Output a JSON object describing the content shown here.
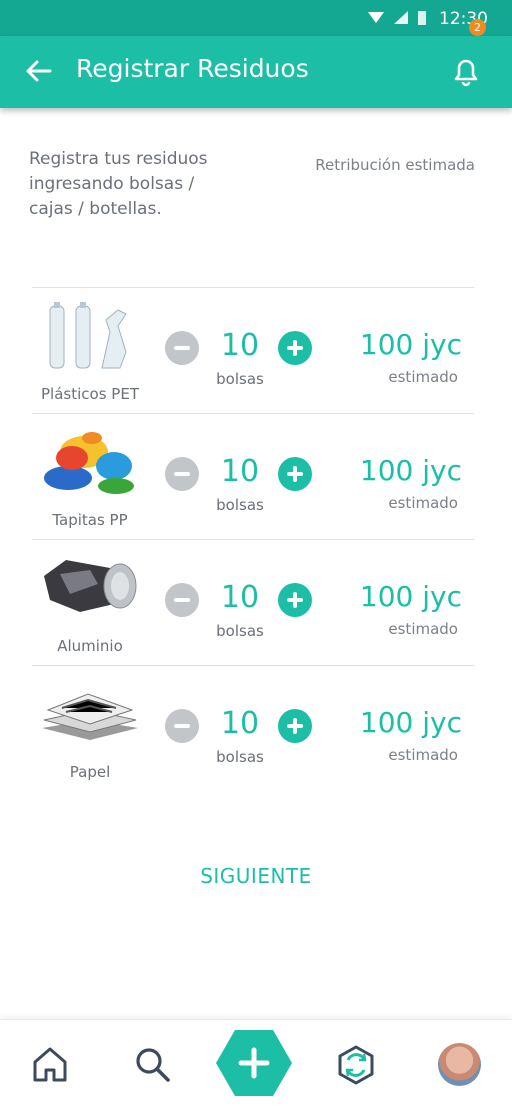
{
  "status": {
    "time": "12:30"
  },
  "header": {
    "title": "Registrar Residuos",
    "notifications": "2"
  },
  "intro": {
    "text": "Registra tus residuos ingresando bolsas / cajas / botellas.",
    "retribution_label": "Retribución estimada"
  },
  "items": [
    {
      "name": "Plásticos PET",
      "quantity": "10",
      "unit": "bolsas",
      "amount": "100 jyc",
      "amount_label": "estimado"
    },
    {
      "name": "Tapitas PP",
      "quantity": "10",
      "unit": "bolsas",
      "amount": "100 jyc",
      "amount_label": "estimado"
    },
    {
      "name": "Aluminio",
      "quantity": "10",
      "unit": "bolsas",
      "amount": "100 jyc",
      "amount_label": "estimado"
    },
    {
      "name": "Papel",
      "quantity": "10",
      "unit": "bolsas",
      "amount": "100 jyc",
      "amount_label": "estimado"
    }
  ],
  "actions": {
    "next_label": "SIGUIENTE"
  },
  "nav": {
    "icons": [
      "home-icon",
      "search-icon",
      "add-icon",
      "recycle-icon",
      "avatar"
    ]
  },
  "colors": {
    "primary": "#1cbfa6",
    "status_bar": "#14a893",
    "badge": "#f28a21",
    "minus": "#c2c5c9"
  }
}
